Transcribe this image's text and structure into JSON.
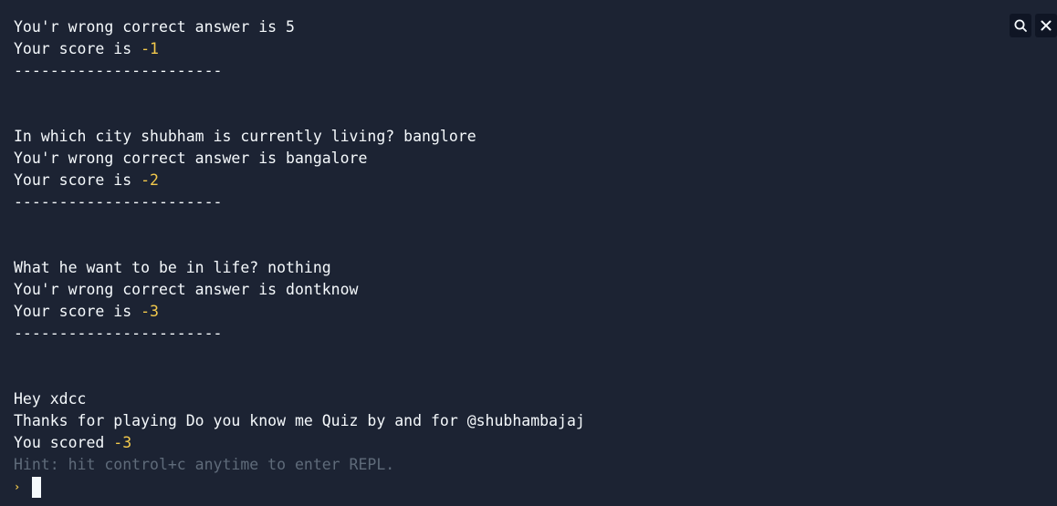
{
  "console": {
    "lines": [
      {
        "kind": "text",
        "text": "You'r wrong correct answer is 5"
      },
      {
        "kind": "score",
        "label": "Your score is ",
        "value": "-1"
      },
      {
        "kind": "text",
        "text": "-----------------------"
      },
      {
        "kind": "blank",
        "text": ""
      },
      {
        "kind": "blank",
        "text": ""
      },
      {
        "kind": "text",
        "text": "In which city shubham is currently living? banglore"
      },
      {
        "kind": "text",
        "text": "You'r wrong correct answer is bangalore"
      },
      {
        "kind": "score",
        "label": "Your score is ",
        "value": "-2"
      },
      {
        "kind": "text",
        "text": "-----------------------"
      },
      {
        "kind": "blank",
        "text": ""
      },
      {
        "kind": "blank",
        "text": ""
      },
      {
        "kind": "text",
        "text": "What he want to be in life? nothing"
      },
      {
        "kind": "text",
        "text": "You'r wrong correct answer is dontknow"
      },
      {
        "kind": "score",
        "label": "Your score is ",
        "value": "-3"
      },
      {
        "kind": "text",
        "text": "-----------------------"
      },
      {
        "kind": "blank",
        "text": ""
      },
      {
        "kind": "blank",
        "text": ""
      },
      {
        "kind": "text",
        "text": "Hey xdcc"
      },
      {
        "kind": "text",
        "text": "Thanks for playing Do you know me Quiz by and for @shubhambajaj"
      },
      {
        "kind": "score",
        "label": "You scored ",
        "value": "-3"
      },
      {
        "kind": "hint",
        "text": "Hint: hit control+c anytime to enter REPL."
      }
    ],
    "prompt_symbol": "›"
  },
  "toolbar": {
    "search_icon": "search-icon",
    "close_icon": "close-icon"
  },
  "colors": {
    "background": "#1c2333",
    "text": "#f5f9fc",
    "number": "#f2c94c",
    "hint": "#5f6b7a"
  }
}
